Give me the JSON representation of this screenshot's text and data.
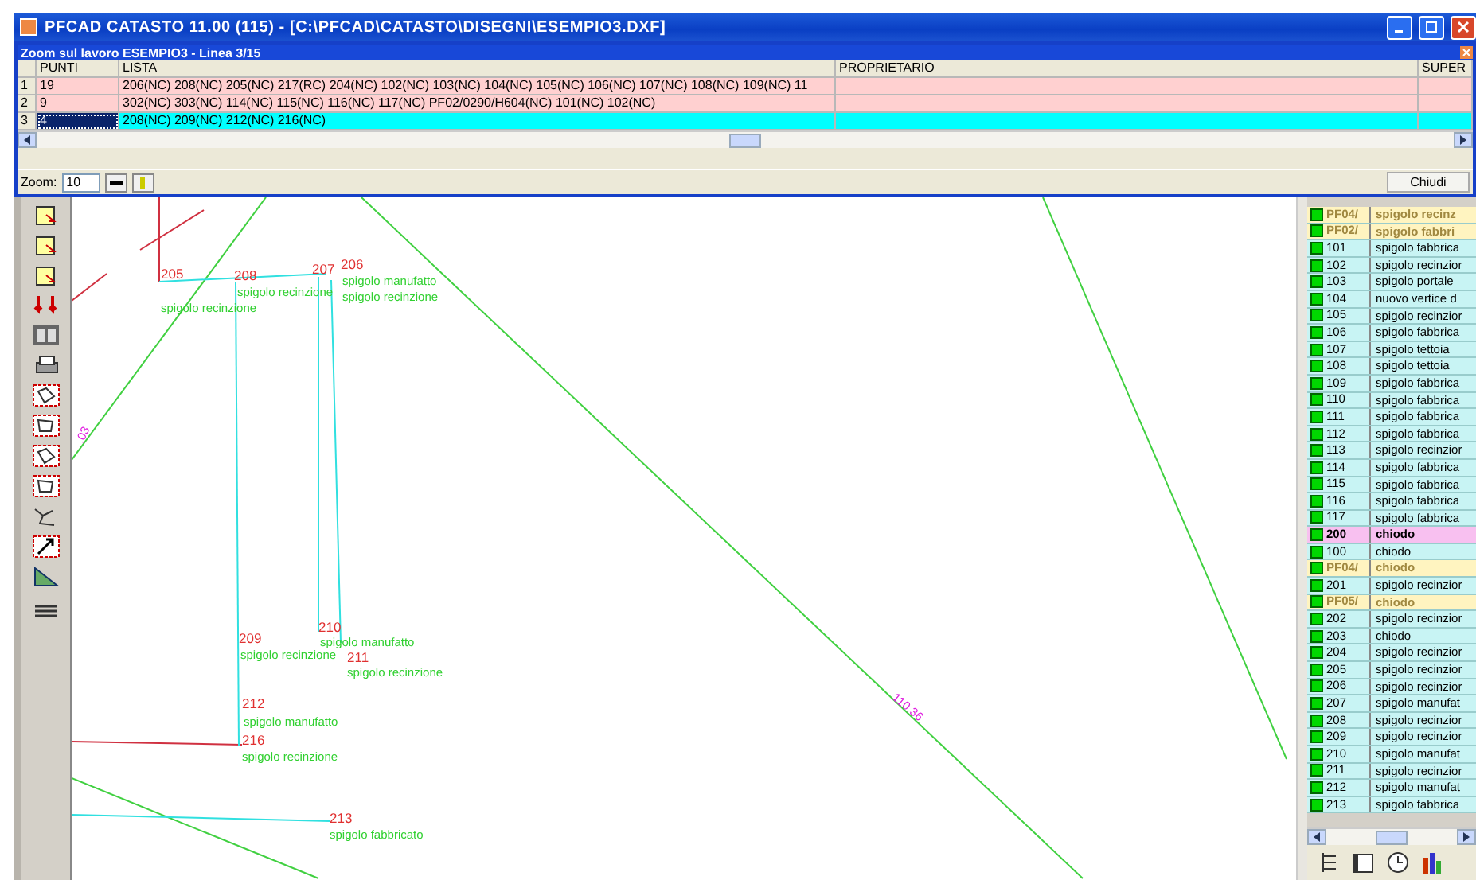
{
  "window": {
    "title": "PFCAD CATASTO 11.00 (115) - [C:\\PFCAD\\CATASTO\\DISEGNI\\ESEMPIO3.DXF]"
  },
  "zoom_panel": {
    "title": "Zoom sul lavoro ESEMPIO3 - Linea 3/15",
    "columns": [
      "PUNTI",
      "LISTA",
      "PROPRIETARIO",
      "SUPER"
    ],
    "rows": [
      {
        "number": "1",
        "punti": "19",
        "lista": "206(NC) 208(NC) 205(NC) 217(RC) 204(NC) 102(NC) 103(NC) 104(NC) 105(NC) 106(NC) 107(NC) 108(NC) 109(NC) 11",
        "selected": false
      },
      {
        "number": "2",
        "punti": "9",
        "lista": "302(NC) 303(NC) 114(NC) 115(NC) 116(NC) 117(NC) PF02/0290/H604(NC) 101(NC) 102(NC)",
        "selected": false
      },
      {
        "number": "3",
        "punti": "4",
        "lista": "208(NC) 209(NC) 212(NC) 216(NC)",
        "selected": true
      }
    ],
    "zoom_label": "Zoom:",
    "zoom_value": "10",
    "close_button": "Chiudi"
  },
  "drawing": {
    "labels": [
      {
        "kind": "number",
        "text": "206"
      },
      {
        "kind": "number",
        "text": "207"
      },
      {
        "kind": "number",
        "text": "205"
      },
      {
        "kind": "number",
        "text": "208"
      },
      {
        "kind": "description",
        "text": "spigolo manufatto"
      },
      {
        "kind": "description",
        "text": "spigolo recinzione"
      },
      {
        "kind": "description",
        "text": "spigolo recinzione"
      },
      {
        "kind": "description",
        "text": "spigolo recinzione"
      },
      {
        "kind": "number",
        "text": "210"
      },
      {
        "kind": "number",
        "text": "209"
      },
      {
        "kind": "description",
        "text": "spigolo manufatto"
      },
      {
        "kind": "description",
        "text": "spigolo recinzione"
      },
      {
        "kind": "number",
        "text": "211"
      },
      {
        "kind": "description",
        "text": "spigolo recinzione"
      },
      {
        "kind": "number",
        "text": "212"
      },
      {
        "kind": "description",
        "text": "spigolo manufatto"
      },
      {
        "kind": "number",
        "text": "216"
      },
      {
        "kind": "description",
        "text": "spigolo recinzione"
      },
      {
        "kind": "number",
        "text": "213"
      },
      {
        "kind": "description",
        "text": "spigolo fabbricato"
      },
      {
        "kind": "measure",
        "text": "110.36"
      },
      {
        "kind": "measure",
        "text": ".03"
      }
    ]
  },
  "point_list": {
    "rows": [
      {
        "id": "PF04/",
        "description": "spigolo recinz",
        "kind": "group",
        "selected": false
      },
      {
        "id": "PF02/",
        "description": "spigolo fabbri",
        "kind": "group",
        "selected": false
      },
      {
        "id": "101",
        "description": "spigolo fabbrica",
        "kind": "point",
        "selected": false
      },
      {
        "id": "102",
        "description": "spigolo recinzior",
        "kind": "point",
        "selected": false
      },
      {
        "id": "103",
        "description": "spigolo portale",
        "kind": "point",
        "selected": false
      },
      {
        "id": "104",
        "description": "nuovo vertice d",
        "kind": "point",
        "selected": false
      },
      {
        "id": "105",
        "description": "spigolo recinzior",
        "kind": "point",
        "selected": false
      },
      {
        "id": "106",
        "description": "spigolo fabbrica",
        "kind": "point",
        "selected": false
      },
      {
        "id": "107",
        "description": "spigolo tettoia",
        "kind": "point",
        "selected": false
      },
      {
        "id": "108",
        "description": "spigolo tettoia",
        "kind": "point",
        "selected": false
      },
      {
        "id": "109",
        "description": "spigolo fabbrica",
        "kind": "point",
        "selected": false
      },
      {
        "id": "110",
        "description": "spigolo fabbrica",
        "kind": "point",
        "selected": false
      },
      {
        "id": "111",
        "description": "spigolo fabbrica",
        "kind": "point",
        "selected": false
      },
      {
        "id": "112",
        "description": "spigolo fabbrica",
        "kind": "point",
        "selected": false
      },
      {
        "id": "113",
        "description": "spigolo recinzior",
        "kind": "point",
        "selected": false
      },
      {
        "id": "114",
        "description": "spigolo fabbrica",
        "kind": "point",
        "selected": false
      },
      {
        "id": "115",
        "description": "spigolo fabbrica",
        "kind": "point",
        "selected": false
      },
      {
        "id": "116",
        "description": "spigolo fabbrica",
        "kind": "point",
        "selected": false
      },
      {
        "id": "117",
        "description": "spigolo fabbrica",
        "kind": "point",
        "selected": false
      },
      {
        "id": "200",
        "description": "chiodo",
        "kind": "point",
        "selected": true
      },
      {
        "id": "100",
        "description": "chiodo",
        "kind": "point",
        "selected": false
      },
      {
        "id": "PF04/",
        "description": "chiodo",
        "kind": "group",
        "selected": false
      },
      {
        "id": "201",
        "description": "spigolo recinzior",
        "kind": "point",
        "selected": false
      },
      {
        "id": "PF05/",
        "description": "chiodo",
        "kind": "group",
        "selected": false
      },
      {
        "id": "202",
        "description": "spigolo recinzior",
        "kind": "point",
        "selected": false
      },
      {
        "id": "203",
        "description": "chiodo",
        "kind": "point",
        "selected": false
      },
      {
        "id": "204",
        "description": "spigolo recinzior",
        "kind": "point",
        "selected": false
      },
      {
        "id": "205",
        "description": "spigolo recinzior",
        "kind": "point",
        "selected": false
      },
      {
        "id": "206",
        "description": "spigolo recinzior",
        "kind": "point",
        "selected": false
      },
      {
        "id": "207",
        "description": "spigolo manufat",
        "kind": "point",
        "selected": false
      },
      {
        "id": "208",
        "description": "spigolo recinzior",
        "kind": "point",
        "selected": false
      },
      {
        "id": "209",
        "description": "spigolo recinzior",
        "kind": "point",
        "selected": false
      },
      {
        "id": "210",
        "description": "spigolo manufat",
        "kind": "point",
        "selected": false
      },
      {
        "id": "211",
        "description": "spigolo recinzior",
        "kind": "point",
        "selected": false
      },
      {
        "id": "212",
        "description": "spigolo manufat",
        "kind": "point",
        "selected": false
      },
      {
        "id": "213",
        "description": "spigolo fabbrica",
        "kind": "point",
        "selected": false
      }
    ]
  }
}
